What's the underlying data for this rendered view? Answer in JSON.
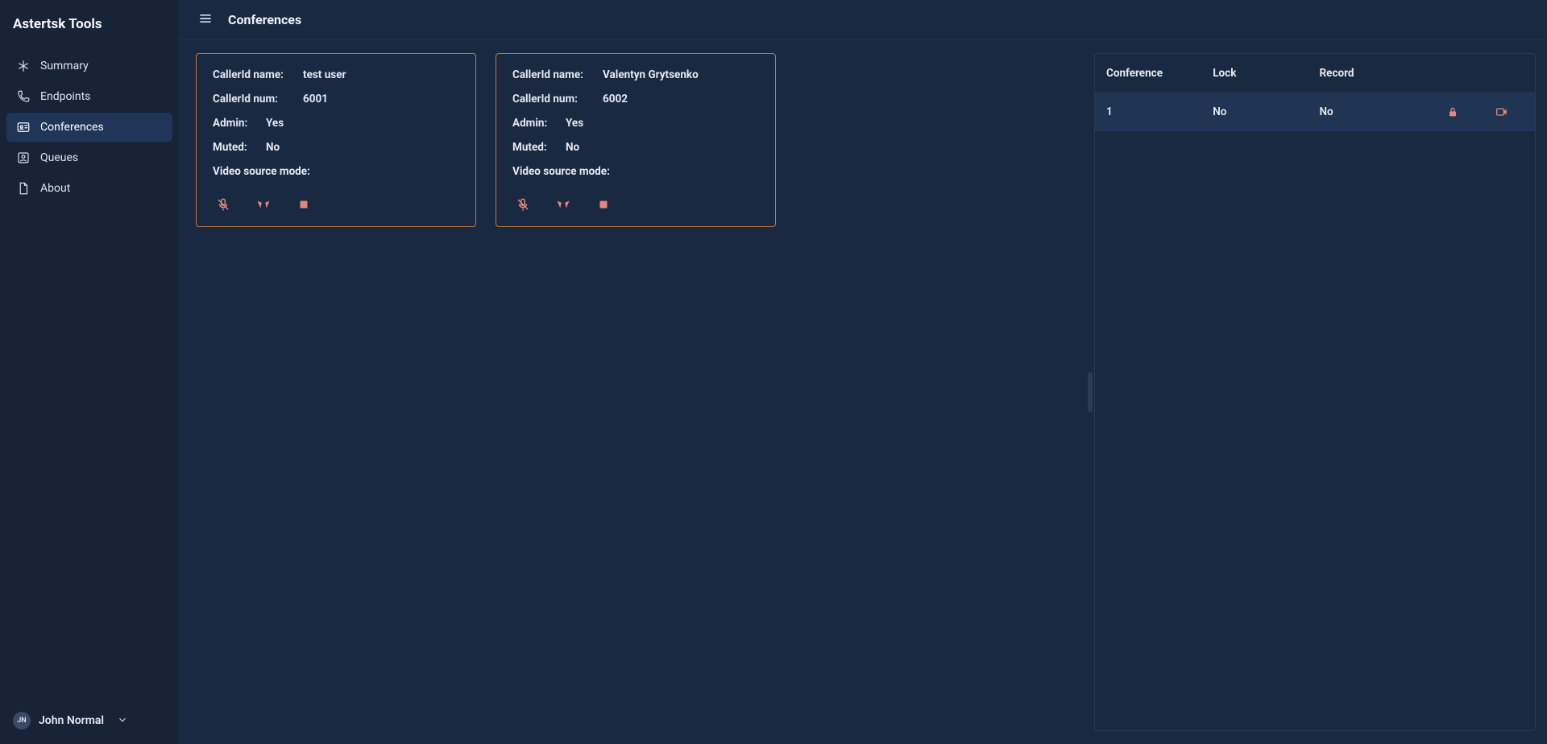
{
  "app_title": "Astertsk Tools",
  "page_title": "Conferences",
  "nav": [
    {
      "label": "Summary"
    },
    {
      "label": "Endpoints"
    },
    {
      "label": "Conferences"
    },
    {
      "label": "Queues"
    },
    {
      "label": "About"
    }
  ],
  "user": {
    "initials": "JN",
    "name": "John Normal"
  },
  "labels": {
    "callerid_name": "CallerId name:",
    "callerid_num": "CallerId num:",
    "admin": "Admin:",
    "muted": "Muted:",
    "video_mode": "Video source mode:"
  },
  "participants": [
    {
      "name": "test user",
      "num": "6001",
      "admin": "Yes",
      "muted": "No",
      "video_mode": ""
    },
    {
      "name": "Valentyn Grytsenko",
      "num": "6002",
      "admin": "Yes",
      "muted": "No",
      "video_mode": ""
    }
  ],
  "table": {
    "headers": {
      "conference": "Conference",
      "lock": "Lock",
      "record": "Record"
    },
    "rows": [
      {
        "conference": "1",
        "lock": "No",
        "record": "No"
      }
    ]
  }
}
